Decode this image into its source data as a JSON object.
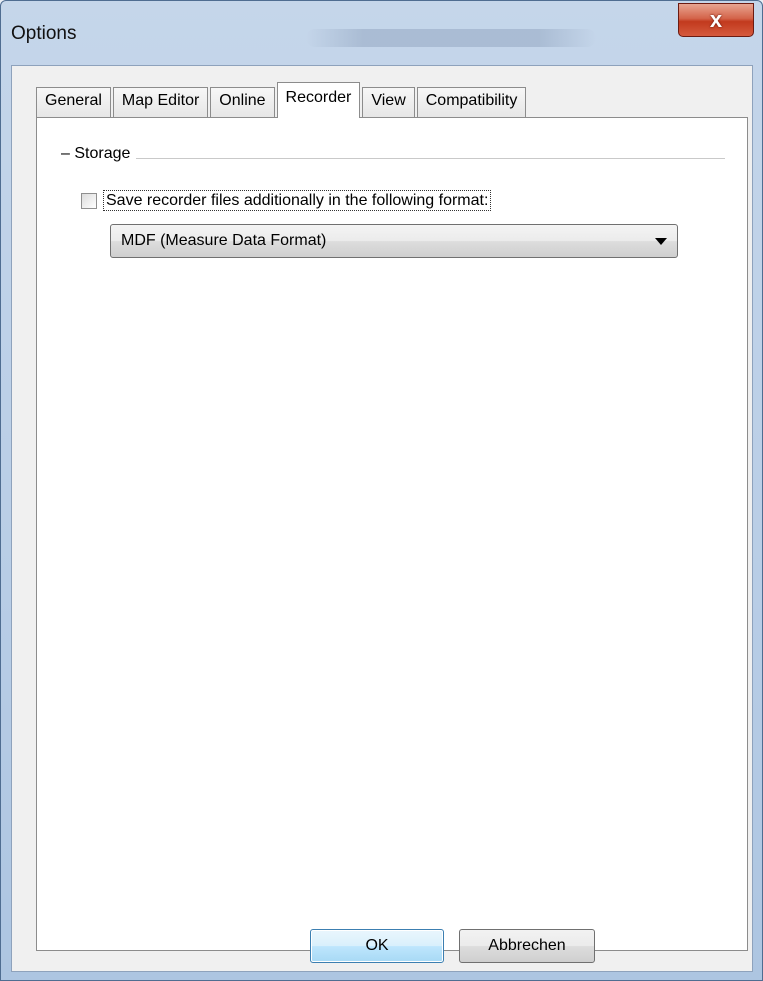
{
  "window": {
    "title": "Options",
    "close_symbol": "x"
  },
  "tabs": [
    {
      "label": "General",
      "active": false
    },
    {
      "label": "Map Editor",
      "active": false
    },
    {
      "label": "Online",
      "active": false
    },
    {
      "label": "Recorder",
      "active": true
    },
    {
      "label": "View",
      "active": false
    },
    {
      "label": "Compatibility",
      "active": false
    }
  ],
  "storage": {
    "group_title": "Storage",
    "checkbox_label": "Save recorder files additionally in the following format:",
    "checkbox_checked": false,
    "format_selected": "MDF  (Measure Data Format)"
  },
  "buttons": {
    "ok_label": "OK",
    "cancel_label": "Abbrechen"
  },
  "colors": {
    "close_button": "#c23a1e",
    "default_button_border": "#3c7fb1"
  }
}
